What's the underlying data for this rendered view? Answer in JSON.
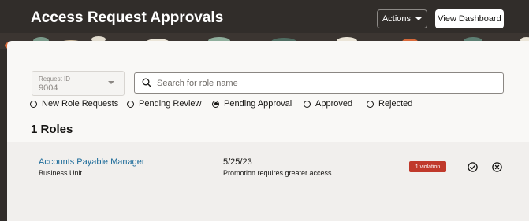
{
  "header": {
    "title": "Access Request Approvals",
    "actions_label": "Actions",
    "dashboard_label": "View Dashboard"
  },
  "filters": {
    "request_id": {
      "label": "Request ID",
      "value": "9004"
    },
    "search": {
      "placeholder": "Search for role name",
      "value": ""
    },
    "radios": [
      {
        "label": "New Role Requests",
        "selected": false
      },
      {
        "label": "Pending Review",
        "selected": false
      },
      {
        "label": "Pending Approval",
        "selected": true
      },
      {
        "label": "Approved",
        "selected": false
      },
      {
        "label": "Rejected",
        "selected": false
      }
    ]
  },
  "results": {
    "count_label": "1 Roles",
    "rows": [
      {
        "role": "Accounts Payable Manager",
        "unit": "Business Unit",
        "date": "5/25/23",
        "reason": "Promotion requires greater access.",
        "violations": "1 violation"
      }
    ]
  },
  "icons": {
    "approve": "check-circle-icon",
    "reject": "x-circle-icon",
    "search": "search-icon",
    "caret": "chevron-down-icon"
  },
  "colors": {
    "header_bg": "#312d2a",
    "panel_bg": "#f9f8f6",
    "link": "#1b6a99",
    "violation": "#c0392b"
  }
}
